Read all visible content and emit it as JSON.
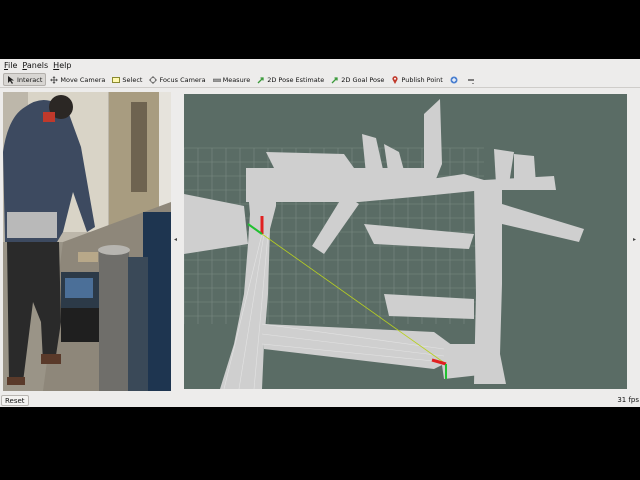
{
  "menubar": {
    "items": [
      "File",
      "Panels",
      "Help"
    ]
  },
  "toolbar": {
    "interact": "Interact",
    "move_camera": "Move Camera",
    "select": "Select",
    "focus_camera": "Focus Camera",
    "measure": "Measure",
    "pose_estimate": "2D Pose Estimate",
    "goal_pose": "2D Goal Pose",
    "publish_point": "Publish Point",
    "active_tool": "Interact"
  },
  "status": {
    "reset_label": "Reset",
    "fps": "31 fps"
  },
  "colors": {
    "viewport_bg": "#5a6c65",
    "map_free": "#cfcfcf",
    "grid": "#7a8a83",
    "axis_x": "#e02020",
    "axis_y": "#20c030",
    "path": "#b8d020",
    "pose_estimate_icon": "#3a9a3a",
    "goal_pose_icon": "#3a9a3a",
    "publish_point_icon": "#c0392b"
  }
}
